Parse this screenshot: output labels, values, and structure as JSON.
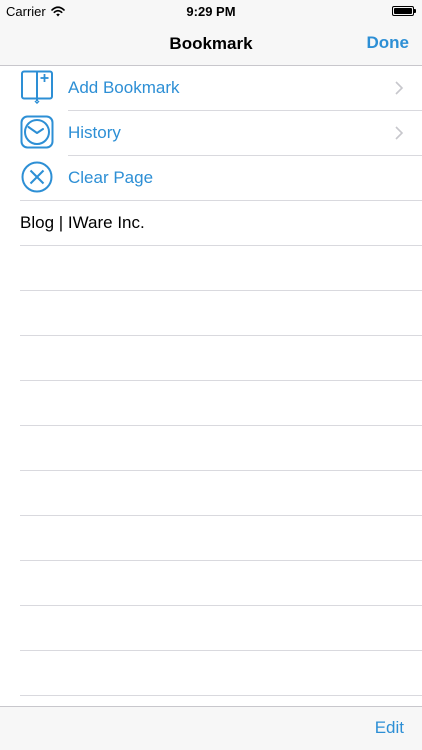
{
  "status_bar": {
    "carrier": "Carrier",
    "time": "9:29 PM",
    "battery_level": 1.0
  },
  "nav": {
    "title": "Bookmark",
    "done_label": "Done"
  },
  "menu": [
    {
      "label": "Add Bookmark",
      "icon": "add-bookmark-icon",
      "has_chevron": true
    },
    {
      "label": "History",
      "icon": "clock-icon",
      "has_chevron": true
    },
    {
      "label": "Clear Page",
      "icon": "clear-icon",
      "has_chevron": false
    }
  ],
  "bookmarks": [
    {
      "title": "Blog | IWare Inc."
    }
  ],
  "toolbar": {
    "edit_label": "Edit"
  },
  "colors": {
    "accent": "#2d8fd5",
    "bar_background": "#f7f7f7",
    "separator": "#d9d9de"
  }
}
